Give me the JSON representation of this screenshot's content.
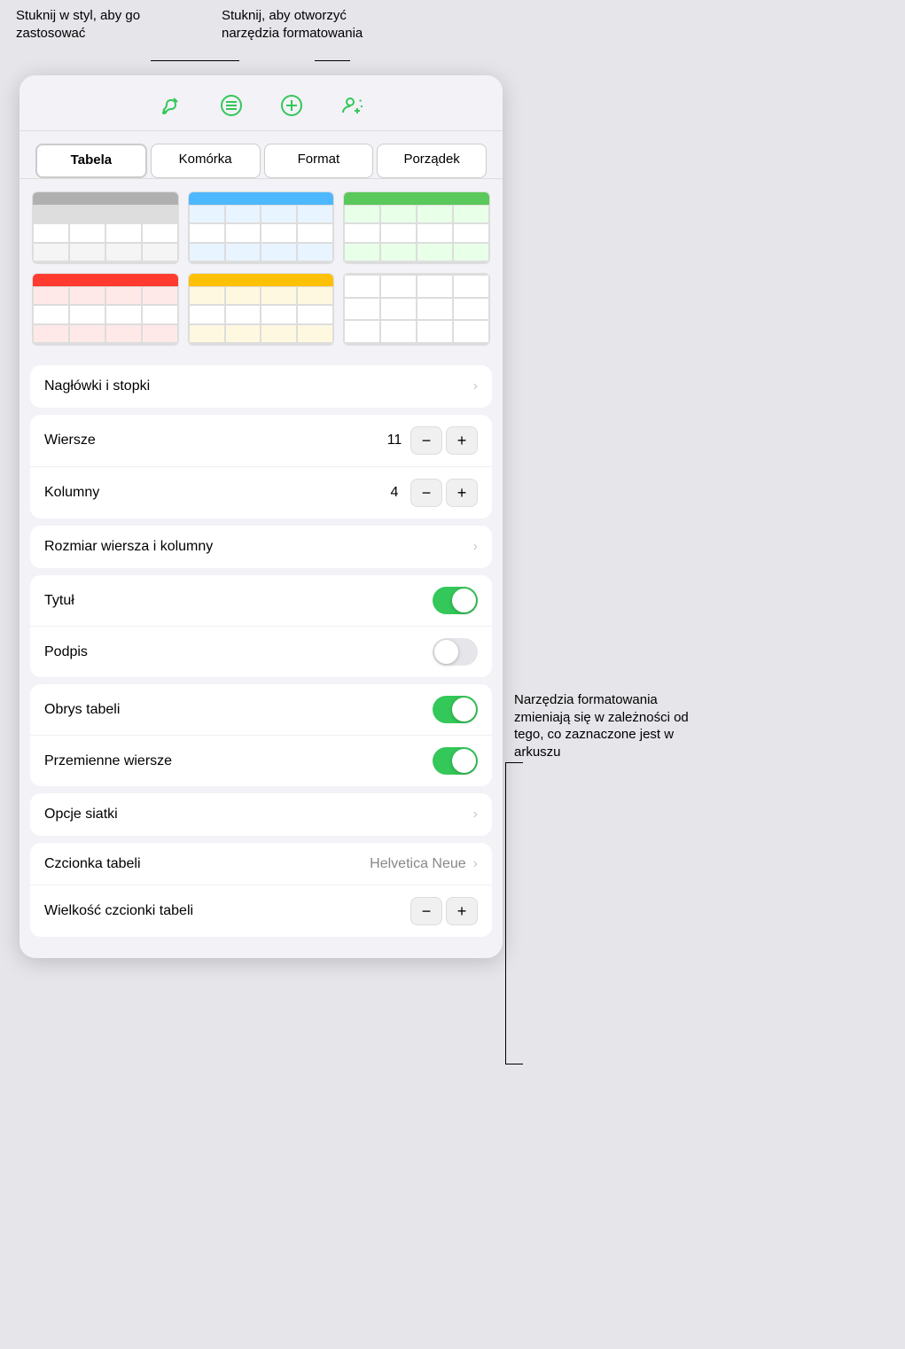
{
  "callouts": {
    "left": "Stuknij w styl, aby go zastosować",
    "right": "Stuknij, aby otworzyć narzędzia formatowania",
    "side": "Narzędzia formatowania zmieniają się w zależności od tego, co zaznaczone jest w arkuszu"
  },
  "toolbar": {
    "icons": [
      "paintbrush",
      "lines",
      "plus",
      "person-add"
    ]
  },
  "tabs": [
    {
      "label": "Tabela",
      "active": true
    },
    {
      "label": "Komórka",
      "active": false
    },
    {
      "label": "Format",
      "active": false
    },
    {
      "label": "Porządek",
      "active": false
    }
  ],
  "styles": [
    {
      "headerColor": "#b0b0b0",
      "type": "gray"
    },
    {
      "headerColor": "#4db8ff",
      "type": "blue"
    },
    {
      "headerColor": "#5ac85a",
      "type": "green"
    },
    {
      "headerColor": "#ff3b30",
      "type": "red"
    },
    {
      "headerColor": "#ffc107",
      "type": "orange"
    },
    {
      "headerColor": "none",
      "type": "plain"
    }
  ],
  "sections": {
    "headers": {
      "label": "Nagłówki i stopki"
    },
    "rows_cols": [
      {
        "label": "Wiersze",
        "value": "11"
      },
      {
        "label": "Kolumny",
        "value": "4"
      }
    ],
    "row_size": {
      "label": "Rozmiar wiersza i kolumny"
    },
    "toggles": [
      {
        "label": "Tytuł",
        "on": true
      },
      {
        "label": "Podpis",
        "on": false
      },
      {
        "label": "Obrys tabeli",
        "on": true
      },
      {
        "label": "Przemienne wiersze",
        "on": true
      }
    ],
    "grid_options": {
      "label": "Opcje siatki"
    },
    "font": {
      "label": "Czcionka tabeli",
      "value": "Helvetica Neue"
    },
    "font_size": {
      "label": "Wielkość czcionki tabeli"
    }
  },
  "buttons": {
    "minus": "−",
    "plus": "+"
  }
}
